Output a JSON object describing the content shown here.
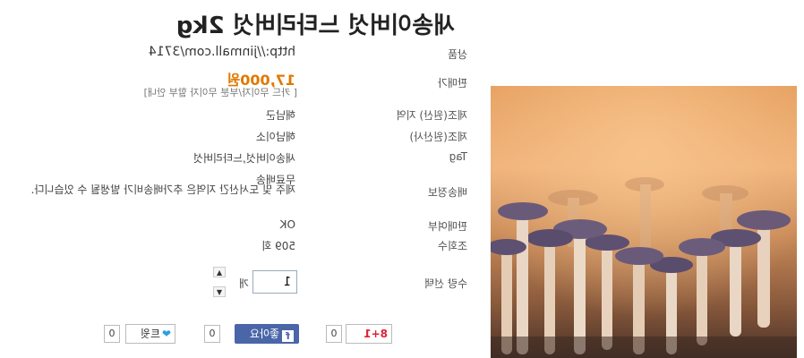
{
  "product": {
    "title": "새송이버섯 느타리버섯 2kg"
  },
  "info_rows": [
    {
      "label": "상품",
      "value": "http://jinmall.com/3714"
    },
    {
      "label": "판매가",
      "value": "17,000원",
      "note": "[ 카드 무이자/부분 무이자 할부 안내]"
    },
    {
      "label": "제조(원산) 지역",
      "value": "해남군"
    },
    {
      "label": "제조(원산사)",
      "value": "해남이소"
    },
    {
      "label": "Tag",
      "value": "새송이버섯,느타리버섯"
    },
    {
      "label": "배송정보",
      "value_line1": "무료배송",
      "value_line2": "제주 및 도서산간 지역은 추가배송비가 발생될 수 있습니다."
    },
    {
      "label": "판매여부",
      "value": "OK"
    },
    {
      "label": "조회수",
      "value": "509 회"
    }
  ],
  "quantity": {
    "label": "수량 선택",
    "value": "1",
    "unit": "개",
    "up_icon": "▲",
    "down_icon": "▼"
  },
  "social": {
    "gplus_label": "8+1",
    "gplus_count": "0",
    "like_label": "좋아요",
    "like_count": "0",
    "tweet_label": "트윗",
    "tweet_count": "0"
  },
  "colors": {
    "price": "#e07800",
    "facebook": "#4a66a8",
    "twitter": "#2aa0e0"
  }
}
